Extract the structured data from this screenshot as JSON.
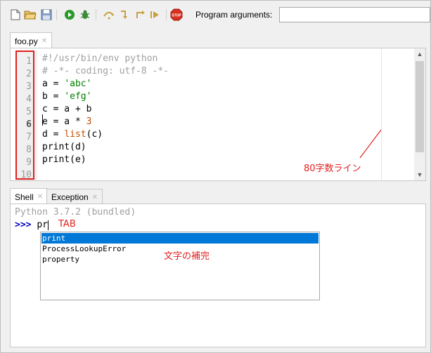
{
  "toolbar": {
    "buttons": [
      {
        "name": "new-file-icon"
      },
      {
        "name": "open-folder-icon"
      },
      {
        "name": "save-icon"
      },
      {
        "name": "run-icon"
      },
      {
        "name": "debug-icon"
      },
      {
        "name": "step-over-icon"
      },
      {
        "name": "step-into-icon"
      },
      {
        "name": "step-out-icon"
      },
      {
        "name": "resume-icon"
      },
      {
        "name": "stop-icon"
      }
    ],
    "stop_label": "STOP",
    "args_label": "Program arguments:",
    "args_value": ""
  },
  "editor": {
    "tab_label": "foo.py",
    "line_numbers": [
      "1",
      "2",
      "3",
      "4",
      "5",
      "6",
      "7",
      "8",
      "9",
      "10"
    ],
    "current_line": "6",
    "code": [
      "#!/usr/bin/env python",
      "# -*- coding: utf-8 -*-",
      "a = 'abc'",
      "b = 'efg'",
      "c = a + b",
      "e = a * 3",
      "d = list(c)",
      "print(d)",
      "print(e)",
      ""
    ]
  },
  "annotations": {
    "margin_note": "80字数ライン",
    "tab_note": "TAB",
    "completion_note": "文字の補完",
    "color": "#e02020"
  },
  "shell": {
    "tabs": [
      {
        "label": "Shell"
      },
      {
        "label": "Exception"
      }
    ],
    "banner": "Python 3.7.2 (bundled)",
    "prompt": ">>>",
    "input": "pr"
  },
  "autocomplete": {
    "items": [
      "print",
      "ProcessLookupError",
      "property"
    ],
    "selected": "print",
    "accent": "#0078d7"
  }
}
